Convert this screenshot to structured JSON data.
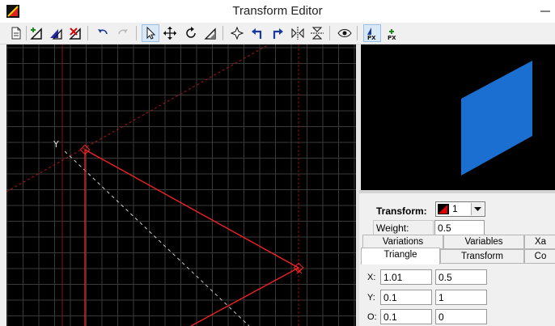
{
  "window": {
    "title": "Transform Editor"
  },
  "toolbar": {
    "buttons": [
      {
        "id": "new",
        "icon": "new-document-icon"
      },
      {
        "id": "add",
        "icon": "add-triangle-icon"
      },
      {
        "id": "duplicate",
        "icon": "duplicate-triangle-icon"
      },
      {
        "id": "delete",
        "icon": "delete-triangle-icon"
      },
      {
        "id": "undo",
        "icon": "undo-icon"
      },
      {
        "id": "redo",
        "icon": "redo-icon"
      },
      {
        "id": "select",
        "icon": "pointer-icon"
      },
      {
        "id": "move",
        "icon": "move-icon"
      },
      {
        "id": "rotate",
        "icon": "rotate-icon"
      },
      {
        "id": "scale",
        "icon": "scale-icon"
      },
      {
        "id": "center",
        "icon": "center-icon"
      },
      {
        "id": "rotate-left",
        "icon": "rotate-left-icon"
      },
      {
        "id": "rotate-right",
        "icon": "rotate-right-icon"
      },
      {
        "id": "flip-h",
        "icon": "flip-horizontal-icon"
      },
      {
        "id": "flip-v",
        "icon": "flip-vertical-icon"
      },
      {
        "id": "preview",
        "icon": "eye-icon"
      },
      {
        "id": "post-transform",
        "icon": "post-transform-icon"
      },
      {
        "id": "add-post-transform",
        "icon": "add-post-transform-icon"
      }
    ]
  },
  "canvas": {
    "axis_label": "Y",
    "grid_color": "#3a3a3a",
    "triangle_color": "#ff0000"
  },
  "preview": {
    "shape_color": "#1a6fd1"
  },
  "panel": {
    "transform_label": "Transform:",
    "transform_value": "1",
    "weight_label": "Weight:",
    "weight_value": "0.5",
    "tabs_row1": [
      "Variations",
      "Variables",
      "Xa"
    ],
    "tabs_row2": [
      "Triangle",
      "Transform",
      "Co"
    ],
    "selected_tab": "Triangle",
    "rows": [
      {
        "label": "X:",
        "a": "1.01",
        "b": "0.5"
      },
      {
        "label": "Y:",
        "a": "0.1",
        "b": "1"
      },
      {
        "label": "O:",
        "a": "0.1",
        "b": "0"
      }
    ]
  }
}
